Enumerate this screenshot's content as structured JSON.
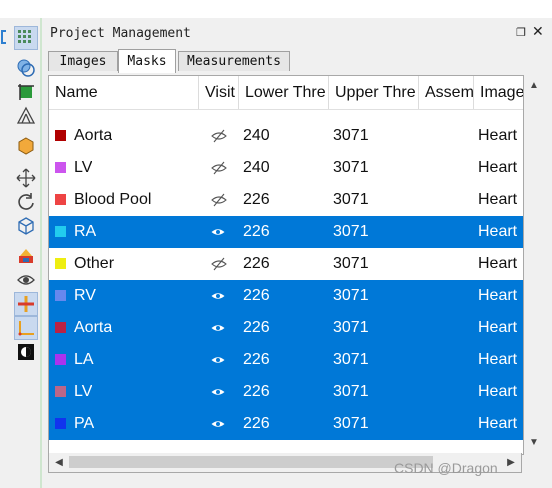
{
  "panel": {
    "title": "Project Management",
    "float_icon": "restore-icon",
    "close_icon": "close-icon"
  },
  "tabs": [
    {
      "label": "Images",
      "active": false
    },
    {
      "label": "Masks",
      "active": true
    },
    {
      "label": "Measurements",
      "active": false
    }
  ],
  "columns": [
    "Name",
    "Visit",
    "Lower Thre",
    "Upper Thre",
    "Assem",
    "Image"
  ],
  "rows": [
    {
      "name": "Aorta",
      "color": "#b00000",
      "visible": false,
      "lower": "240",
      "upper": "3071",
      "image": "Heart",
      "selected": false
    },
    {
      "name": "LV",
      "color": "#cc55ee",
      "visible": false,
      "lower": "240",
      "upper": "3071",
      "image": "Heart",
      "selected": false
    },
    {
      "name": "Blood Pool",
      "color": "#ee4444",
      "visible": false,
      "lower": "226",
      "upper": "3071",
      "image": "Heart",
      "selected": false
    },
    {
      "name": "RA",
      "color": "#22ccee",
      "visible": true,
      "lower": "226",
      "upper": "3071",
      "image": "Heart",
      "selected": true
    },
    {
      "name": "Other",
      "color": "#eeee11",
      "visible": false,
      "lower": "226",
      "upper": "3071",
      "image": "Heart",
      "selected": false
    },
    {
      "name": "RV",
      "color": "#6688ee",
      "visible": true,
      "lower": "226",
      "upper": "3071",
      "image": "Heart",
      "selected": true
    },
    {
      "name": "Aorta",
      "color": "#bb2244",
      "visible": true,
      "lower": "226",
      "upper": "3071",
      "image": "Heart",
      "selected": true
    },
    {
      "name": "LA",
      "color": "#aa33ee",
      "visible": true,
      "lower": "226",
      "upper": "3071",
      "image": "Heart",
      "selected": true
    },
    {
      "name": "LV",
      "color": "#bb6688",
      "visible": true,
      "lower": "226",
      "upper": "3071",
      "image": "Heart",
      "selected": true
    },
    {
      "name": "PA",
      "color": "#1133ee",
      "visible": true,
      "lower": "226",
      "upper": "3071",
      "image": "Heart",
      "selected": true
    }
  ],
  "watermark": "CSDN @Dragon",
  "toolbar_icons": [
    "grid-icon",
    "mask-icon",
    "crop-icon",
    "triangle-icon",
    "hexagon-icon",
    "move-icon",
    "rotate-icon",
    "cube-icon",
    "layers-icon",
    "eye-icon",
    "crosshair-icon",
    "axis-icon",
    "contrast-icon"
  ]
}
